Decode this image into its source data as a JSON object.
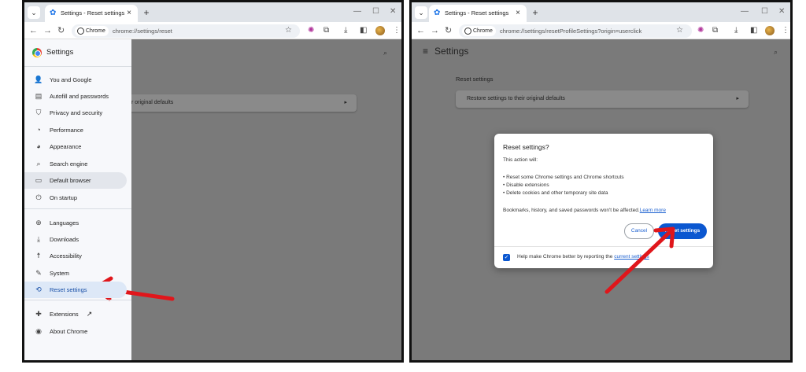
{
  "left": {
    "tab_title": "Settings - Reset settings",
    "tab_close": "×",
    "new_tab": "+",
    "chip_label": "Chrome",
    "url": "chrome://settings/reset",
    "settings_title": "Settings",
    "ghost_row_text": "r original defaults",
    "ghost_row_chevron": "▸",
    "sidebar_items": [
      {
        "label": "You and Google",
        "icon": "person-icon",
        "glyph": "👤"
      },
      {
        "label": "Autofill and passwords",
        "icon": "clipboard-icon",
        "glyph": "▤"
      },
      {
        "label": "Privacy and security",
        "icon": "shield-icon",
        "glyph": "⛉"
      },
      {
        "label": "Performance",
        "icon": "gauge-icon",
        "glyph": "◔"
      },
      {
        "label": "Appearance",
        "icon": "palette-icon",
        "glyph": "◕"
      },
      {
        "label": "Search engine",
        "icon": "search-icon",
        "glyph": "⌕"
      },
      {
        "label": "Default browser",
        "icon": "browser-icon",
        "glyph": "▭"
      },
      {
        "label": "On startup",
        "icon": "power-icon",
        "glyph": "⏻"
      },
      {
        "label": "Languages",
        "icon": "globe-icon",
        "glyph": "⊕"
      },
      {
        "label": "Downloads",
        "icon": "download-icon",
        "glyph": "⤓"
      },
      {
        "label": "Accessibility",
        "icon": "accessibility-icon",
        "glyph": "☨"
      },
      {
        "label": "System",
        "icon": "wrench-icon",
        "glyph": "✎"
      },
      {
        "label": "Reset settings",
        "icon": "history-icon",
        "glyph": "⟲"
      },
      {
        "label": "Extensions",
        "icon": "puzzle-icon",
        "glyph": "✚"
      },
      {
        "label": "About Chrome",
        "icon": "chrome-icon",
        "glyph": "◉"
      }
    ],
    "external_link_glyph": "↗"
  },
  "right": {
    "tab_title": "Settings - Reset settings",
    "tab_close": "×",
    "new_tab": "+",
    "chip_label": "Chrome",
    "url": "chrome://settings/resetProfileSettings?origin=userclick",
    "settings_title": "Settings",
    "section_title": "Reset settings",
    "row_text": "Restore settings to their original defaults",
    "row_chevron": "▸",
    "dialog": {
      "title": "Reset settings?",
      "intro": "This action will:",
      "bullets": [
        "• Reset some Chrome settings and Chrome shortcuts",
        "• Disable extensions",
        "• Delete cookies and other temporary site data"
      ],
      "note": "Bookmarks, history, and saved passwords won't be affected.",
      "learn_more": "Learn more",
      "cancel": "Cancel",
      "reset": "Reset settings",
      "checkbox_text": "Help make Chrome better by reporting the ",
      "checkbox_link": "current settings"
    }
  },
  "colors": {
    "accent": "#0b57d0",
    "arrow": "#e0161b",
    "overlay": "#7a7a7a"
  }
}
